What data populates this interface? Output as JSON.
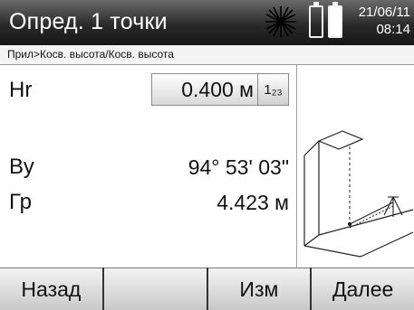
{
  "header": {
    "title": "Опред. 1 точки",
    "date": "21/06/11",
    "time": "08:14"
  },
  "breadcrumb": "Прил>Косв. высота/Косв. высота",
  "fields": {
    "hr": {
      "label": "Hr",
      "value": "0.400 м",
      "unit_button": "1₂₃"
    },
    "vy": {
      "label": "Ву",
      "value": "94° 53' 03\""
    },
    "gr": {
      "label": "Гр",
      "value": "4.423 м"
    }
  },
  "softkeys": {
    "back": "Назад",
    "empty": "",
    "edit": "Изм",
    "next": "Далее"
  },
  "icons": {
    "laser": "laser-sun-icon",
    "battery1": "battery-outline-icon",
    "battery2": "battery-full-icon",
    "diagram": "indirect-height-diagram"
  }
}
